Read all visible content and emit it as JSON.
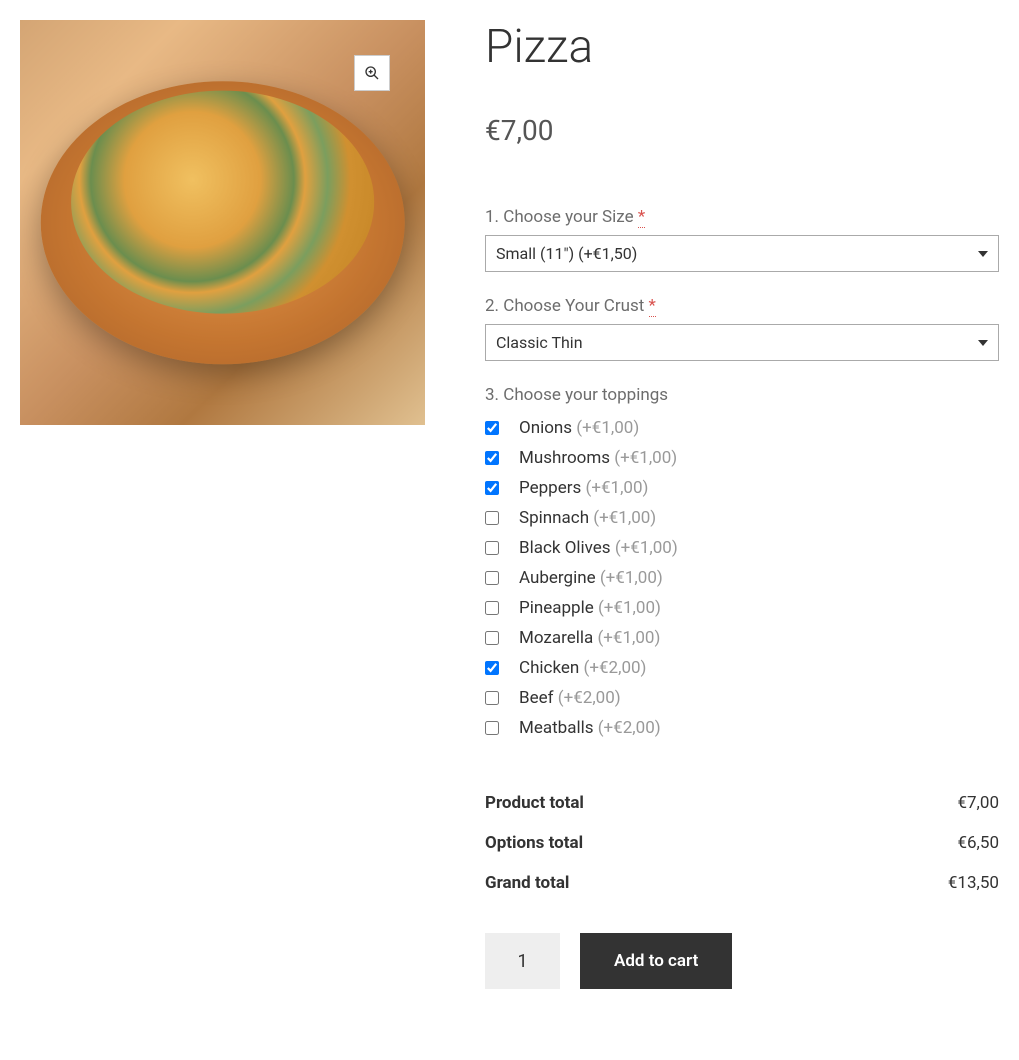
{
  "product": {
    "title": "Pizza",
    "price": "€7,00"
  },
  "options": {
    "size": {
      "label": "1. Choose your Size",
      "required": "*",
      "selected": "Small (11\") (+€1,50)"
    },
    "crust": {
      "label": "2. Choose Your Crust",
      "required": "*",
      "selected": "Classic Thin"
    },
    "toppings": {
      "label": "3. Choose your toppings",
      "items": [
        {
          "name": "Onions",
          "price": "(+€1,00)",
          "checked": true
        },
        {
          "name": "Mushrooms",
          "price": "(+€1,00)",
          "checked": true
        },
        {
          "name": "Peppers",
          "price": "(+€1,00)",
          "checked": true
        },
        {
          "name": "Spinnach",
          "price": "(+€1,00)",
          "checked": false
        },
        {
          "name": "Black Olives",
          "price": "(+€1,00)",
          "checked": false
        },
        {
          "name": "Aubergine",
          "price": "(+€1,00)",
          "checked": false
        },
        {
          "name": "Pineapple",
          "price": "(+€1,00)",
          "checked": false
        },
        {
          "name": "Mozarella",
          "price": "(+€1,00)",
          "checked": false
        },
        {
          "name": "Chicken",
          "price": "(+€2,00)",
          "checked": true
        },
        {
          "name": "Beef",
          "price": "(+€2,00)",
          "checked": false
        },
        {
          "name": "Meatballs",
          "price": "(+€2,00)",
          "checked": false
        }
      ]
    }
  },
  "totals": {
    "product": {
      "label": "Product total",
      "value": "€7,00"
    },
    "options": {
      "label": "Options total",
      "value": "€6,50"
    },
    "grand": {
      "label": "Grand total",
      "value": "€13,50"
    }
  },
  "cart": {
    "quantity": "1",
    "button": "Add to cart"
  }
}
